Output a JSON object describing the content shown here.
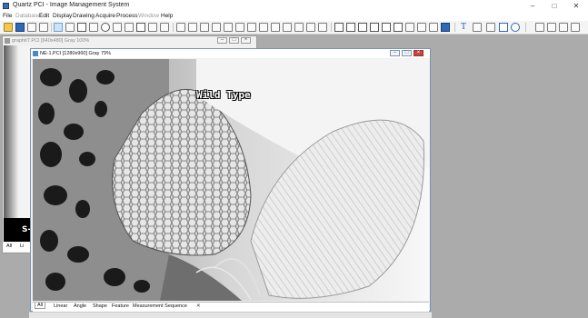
{
  "app": {
    "title": "Quartz PCI - Image Management System",
    "window_controls": [
      "–",
      "□",
      "✕"
    ]
  },
  "menu": [
    {
      "label": "File",
      "enabled": true
    },
    {
      "label": "Database",
      "enabled": false
    },
    {
      "label": "Edit",
      "enabled": true
    },
    {
      "label": "Display",
      "enabled": true
    },
    {
      "label": "Drawing",
      "enabled": true
    },
    {
      "label": "Acquire",
      "enabled": true
    },
    {
      "label": "Process",
      "enabled": true
    },
    {
      "label": "Window",
      "enabled": false
    },
    {
      "label": "Help",
      "enabled": true
    }
  ],
  "toolbar": {
    "text_tool": "T",
    "tools": [
      "open-folder",
      "save",
      "print",
      "copy",
      "pointer",
      "zoom-in",
      "select-rect",
      "hand",
      "measure-length",
      "measure-angle",
      "ruler",
      "calibration",
      "histogram",
      "filter",
      "enhance",
      "magnify-1",
      "magnify-2",
      "zoom-out",
      "zoom-fit",
      "rectangle",
      "ellipse",
      "polygon",
      "freehand",
      "line-tool",
      "text-tool",
      "pen-tool",
      "link",
      "rectangle-shape",
      "ellipse-shape",
      "grid-1",
      "grid-2",
      "grid-3"
    ]
  },
  "windows": [
    {
      "title": "graphit7.PCI [640x480] Gray 100%",
      "overlay_label": "S-",
      "tabs": [
        "All",
        "Li"
      ]
    },
    {
      "title": "NE-1.PCI [1280x960] Gray 79%",
      "overlay_label": "Wild Type",
      "tabs": [
        "All",
        "Linear",
        "Angle",
        "Shape",
        "Feature",
        "Measurement Sequence"
      ]
    }
  ]
}
